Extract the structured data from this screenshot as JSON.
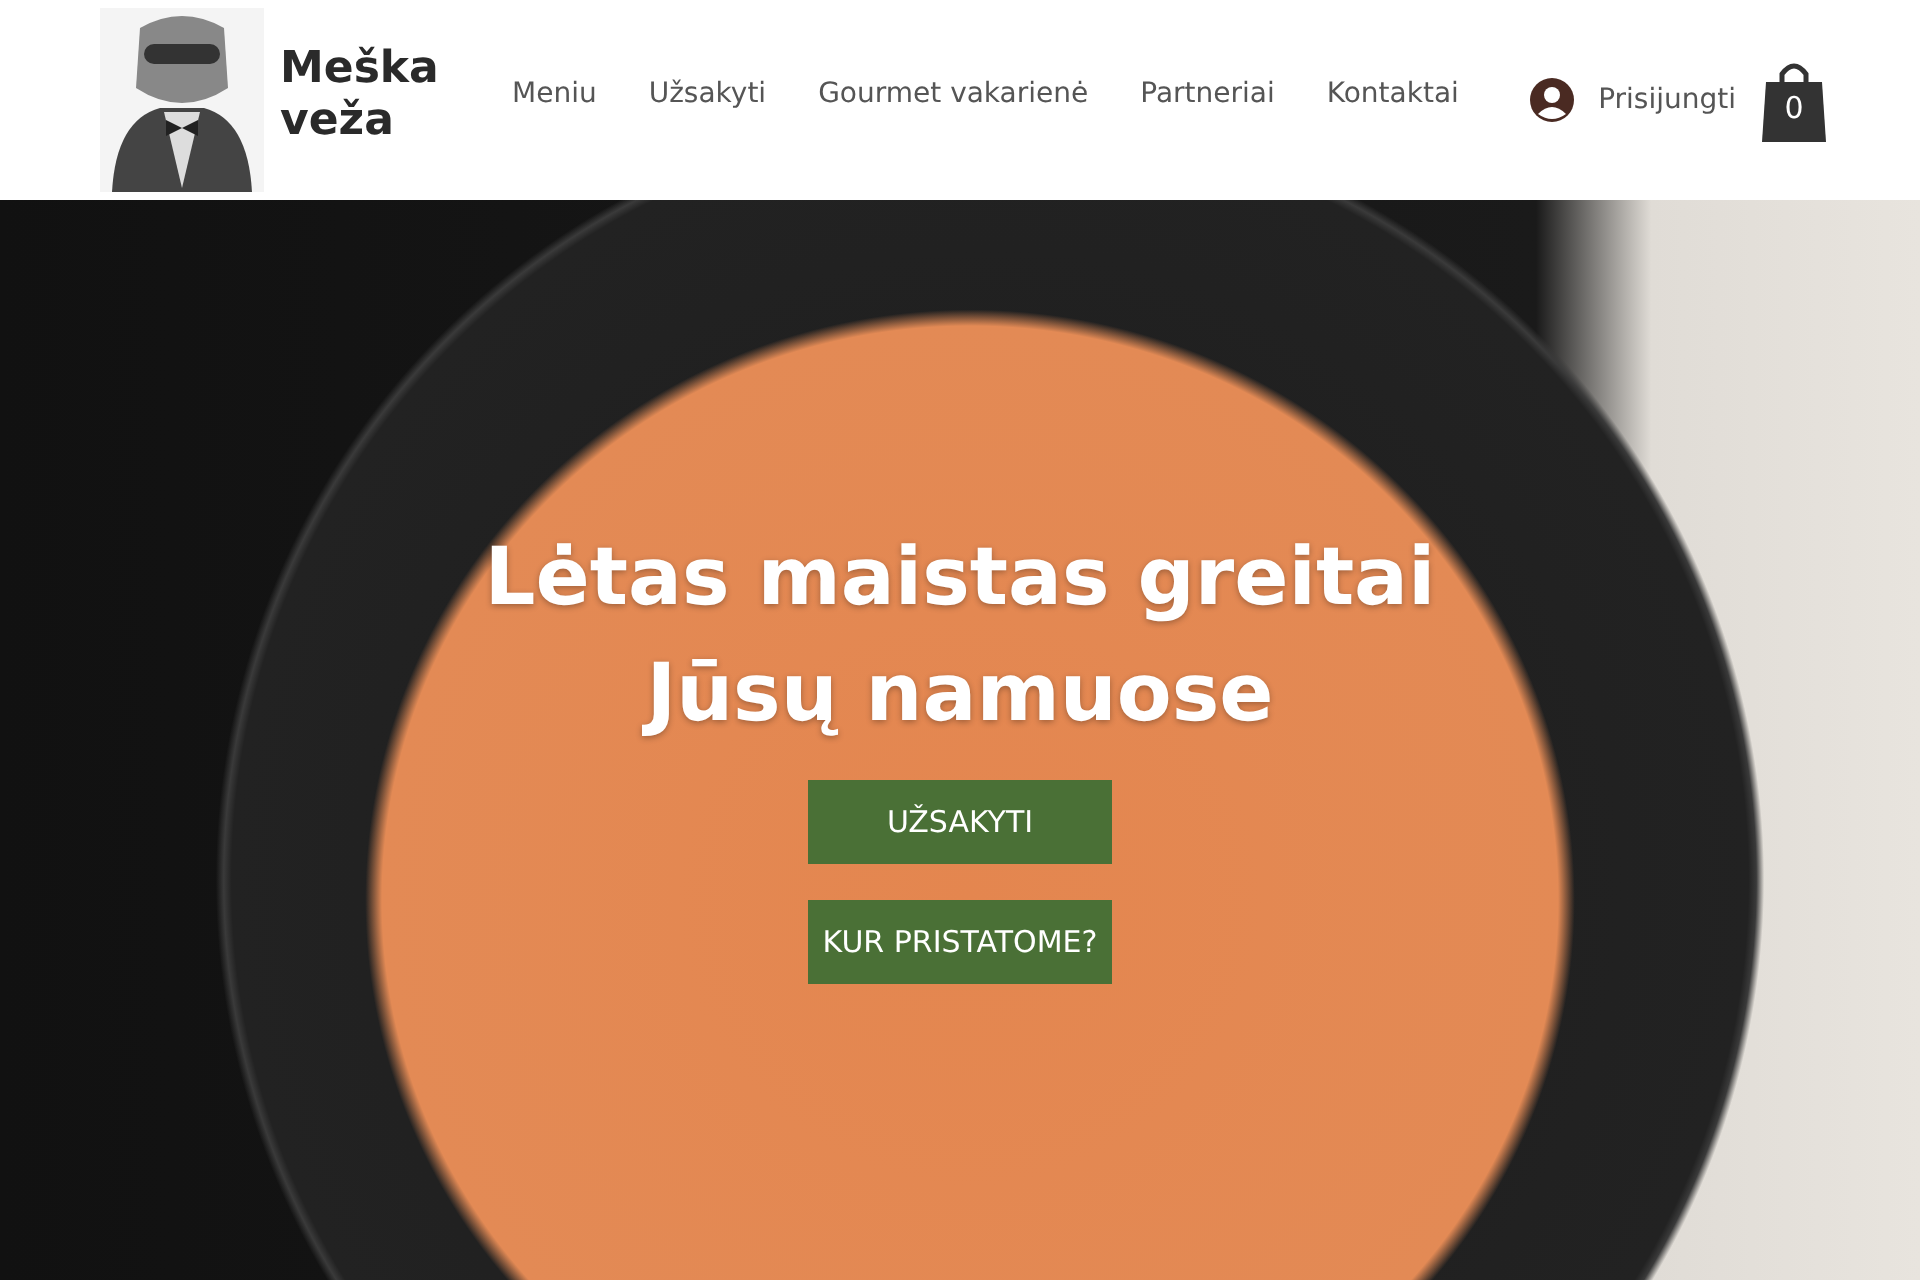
{
  "header": {
    "brand": "Meška\nveža",
    "nav": [
      {
        "label": "Meniu"
      },
      {
        "label": "Užsakyti"
      },
      {
        "label": "Gourmet vakarienė"
      },
      {
        "label": "Partneriai"
      },
      {
        "label": "Kontaktai"
      }
    ],
    "login": "Prisijungti",
    "cart_count": "0"
  },
  "hero": {
    "headline": "Lėtas maistas greitai\nJūsų namuose",
    "buttons": [
      "UŽSAKYTI",
      "KUR PRISTATOME?"
    ]
  }
}
